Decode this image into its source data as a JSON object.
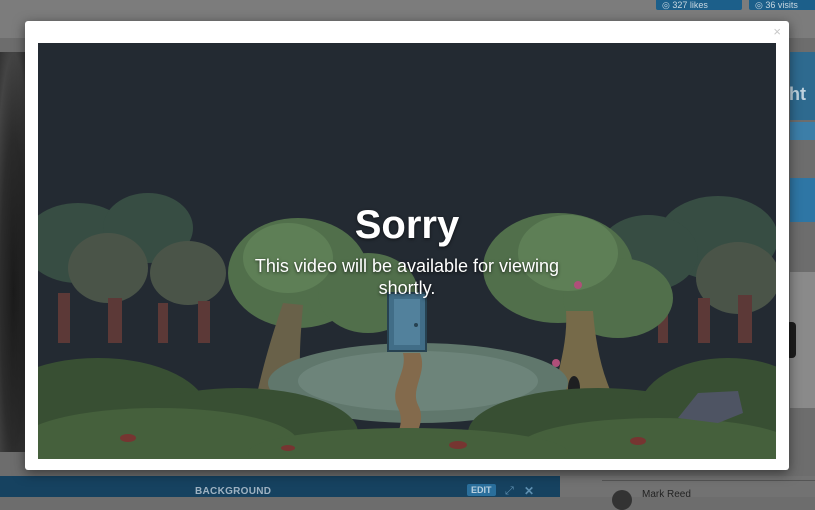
{
  "background": {
    "top_buttons": [
      "◎ 327 likes",
      "◎ 36 visits"
    ],
    "right_heading_fragment": "ght",
    "bottom_bar": {
      "label": "BACKGROUND",
      "edit_label": "EDIT"
    },
    "user_name": "Mark Reed"
  },
  "modal": {
    "close_glyph": "×",
    "title": "Sorry",
    "message": "This video will be available for viewing shortly."
  },
  "colors": {
    "overlay": "#6d6d6d",
    "video_bg": "#252d34",
    "accent_blue": "#1c5f8a",
    "bottom_bar": "#164260"
  },
  "icons": [
    "close-icon",
    "expand-icon",
    "remove-icon",
    "forest-door-illustration"
  ]
}
